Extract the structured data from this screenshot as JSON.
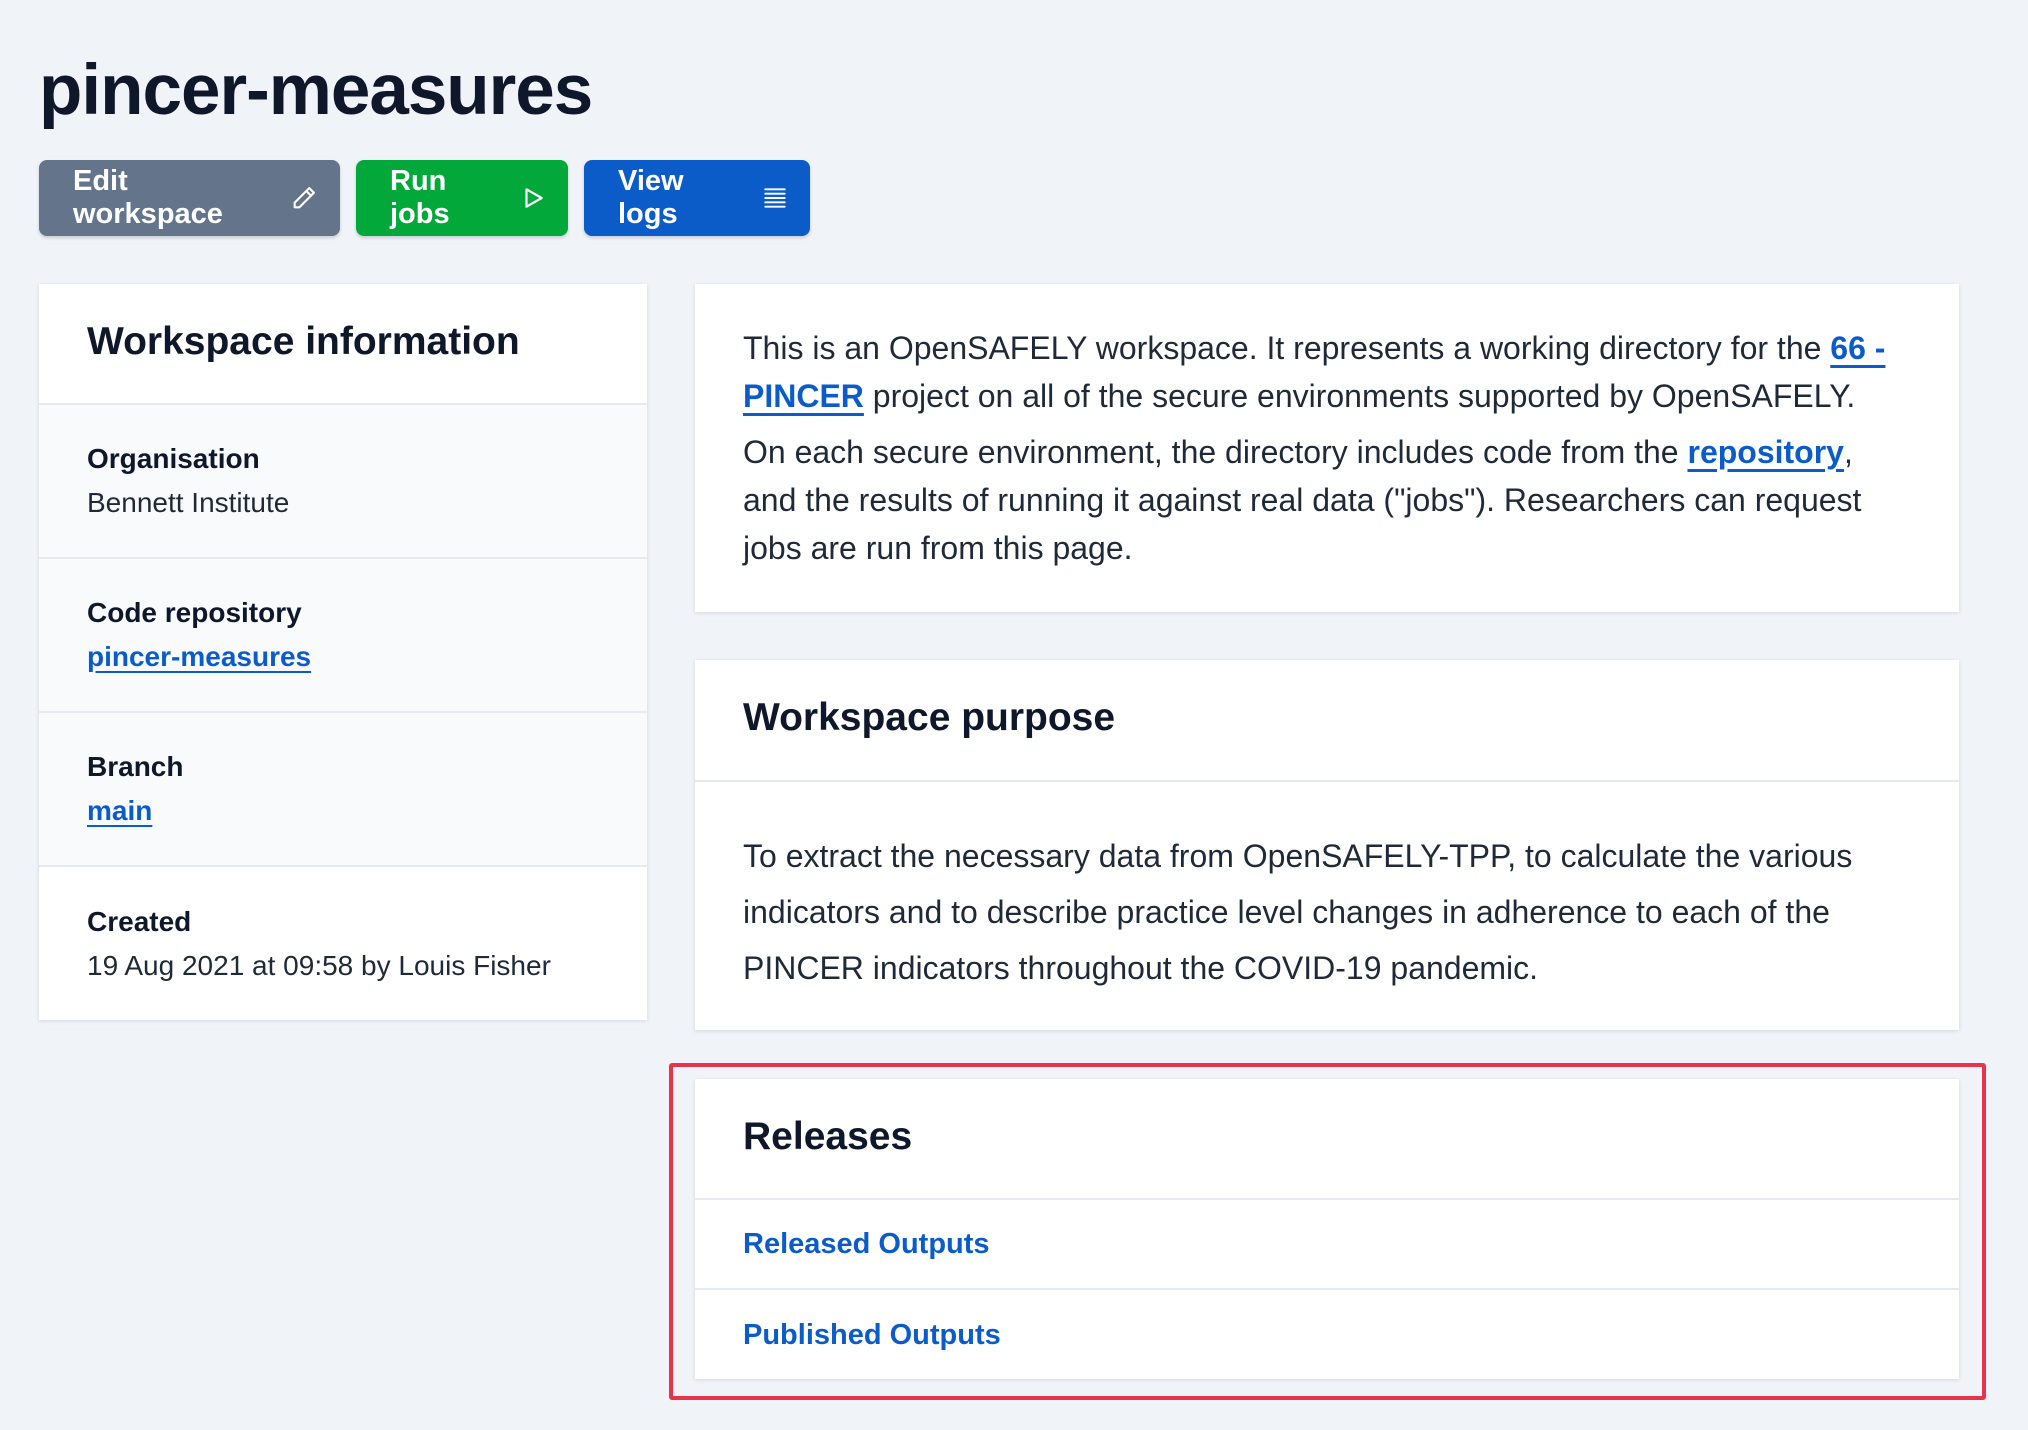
{
  "page": {
    "title": "pincer-measures"
  },
  "actions": {
    "edit_label": "Edit workspace",
    "run_label": "Run jobs",
    "logs_label": "View logs"
  },
  "info": {
    "heading": "Workspace information",
    "organisation": {
      "label": "Organisation",
      "value": "Bennett Institute"
    },
    "repo": {
      "label": "Code repository",
      "value": "pincer-measures"
    },
    "branch": {
      "label": "Branch",
      "value": "main"
    },
    "created": {
      "label": "Created",
      "value": "19 Aug 2021 at 09:58 by Louis Fisher"
    }
  },
  "description": {
    "p1_before": "This is an OpenSAFELY workspace. It represents a working directory for the ",
    "project_link": "66 - PINCER",
    "p1_after": " project on all of the secure environments supported by OpenSAFELY.",
    "p2_before": "On each secure environment, the directory includes code from the ",
    "repo_link": "repository",
    "p2_after": ", and the results of running it against real data (\"jobs\"). Researchers can request jobs are run from this page."
  },
  "purpose": {
    "heading": "Workspace purpose",
    "text": "To extract the necessary data from OpenSAFELY-TPP, to calculate the various indicators and to describe practice level changes in adherence to each of the PINCER indicators throughout the COVID-19 pandemic."
  },
  "releases": {
    "heading": "Releases",
    "links": [
      {
        "label": "Released Outputs"
      },
      {
        "label": "Published Outputs"
      }
    ]
  },
  "colors": {
    "background": "#f0f4f9",
    "edit_button": "#64748b",
    "run_button": "#02a93a",
    "logs_button": "#0b5cc9",
    "link": "#0b5cc9",
    "highlight": "#e8334a"
  },
  "icons": {
    "edit": "pencil-icon",
    "run": "play-icon",
    "logs": "list-icon"
  }
}
